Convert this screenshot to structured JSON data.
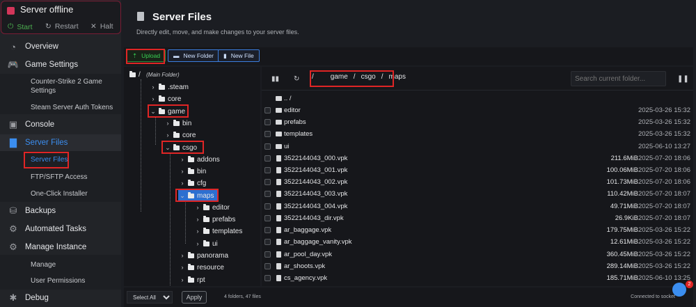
{
  "server": {
    "status": "Server offline",
    "start": "Start",
    "restart": "Restart",
    "halt": "Halt"
  },
  "sidebar": {
    "overview": "Overview",
    "game_settings": "Game Settings",
    "cs2_settings": "Counter-Strike 2 Game Settings",
    "auth_tokens": "Steam Server Auth Tokens",
    "console": "Console",
    "server_files": "Server Files",
    "server_files_sub": "Server Files",
    "ftp": "FTP/SFTP Access",
    "installer": "One-Click Installer",
    "backups": "Backups",
    "tasks": "Automated Tasks",
    "manage": "Manage Instance",
    "manage_sub": "Manage",
    "user_perms": "User Permissions",
    "debug": "Debug"
  },
  "page": {
    "title": "Server Files",
    "subtitle": "Directly edit, move, and make changes to your server files."
  },
  "toolbar": {
    "upload": "Upload",
    "new_folder": "New Folder",
    "new_file": "New File"
  },
  "tree": {
    "root": "/",
    "root_note": "(Main Folder)",
    "nodes": [
      ".steam",
      "core",
      "game",
      "bin",
      "core",
      "csgo",
      "addons",
      "bin",
      "cfg",
      "maps",
      "editor",
      "prefabs",
      "templates",
      "ui",
      "panorama",
      "resource",
      "rpt"
    ]
  },
  "breadcrumb": {
    "root": "/",
    "p1": "game",
    "s1": "/",
    "p2": "csgo",
    "s2": "/",
    "p3": "maps"
  },
  "search": {
    "placeholder": "Search current folder..."
  },
  "files": [
    {
      "name": ".. /",
      "size": "",
      "date": ""
    },
    {
      "name": "editor",
      "size": "",
      "date": "2025-03-26 15:32"
    },
    {
      "name": "prefabs",
      "size": "",
      "date": "2025-03-26 15:32"
    },
    {
      "name": "templates",
      "size": "",
      "date": "2025-03-26 15:32"
    },
    {
      "name": "ui",
      "size": "",
      "date": "2025-06-10 13:27"
    },
    {
      "name": "3522144043_000.vpk",
      "size": "211.6MiB",
      "date": "2025-07-20 18:06"
    },
    {
      "name": "3522144043_001.vpk",
      "size": "100.06MiB",
      "date": "2025-07-20 18:06"
    },
    {
      "name": "3522144043_002.vpk",
      "size": "101.73MiB",
      "date": "2025-07-20 18:06"
    },
    {
      "name": "3522144043_003.vpk",
      "size": "110.42MiB",
      "date": "2025-07-20 18:07"
    },
    {
      "name": "3522144043_004.vpk",
      "size": "49.71MiB",
      "date": "2025-07-20 18:07"
    },
    {
      "name": "3522144043_dir.vpk",
      "size": "26.9KiB",
      "date": "2025-07-20 18:07"
    },
    {
      "name": "ar_baggage.vpk",
      "size": "179.75MiB",
      "date": "2025-03-26 15:22"
    },
    {
      "name": "ar_baggage_vanity.vpk",
      "size": "12.61MiB",
      "date": "2025-03-26 15:22"
    },
    {
      "name": "ar_pool_day.vpk",
      "size": "360.45MiB",
      "date": "2025-03-26 15:22"
    },
    {
      "name": "ar_shoots.vpk",
      "size": "289.14MiB",
      "date": "2025-03-26 15:22"
    },
    {
      "name": "cs_agency.vpk",
      "size": "185.71MiB",
      "date": "2025-06-10 13:25"
    }
  ],
  "footer": {
    "select": "Select All",
    "apply": "Apply",
    "count": "4 folders, 47 files",
    "connection": "Connected to socket",
    "badge": "2"
  },
  "colors": {
    "accent": "#3b8ef0",
    "danger": "#e02525",
    "upload_green": "#39d353"
  }
}
